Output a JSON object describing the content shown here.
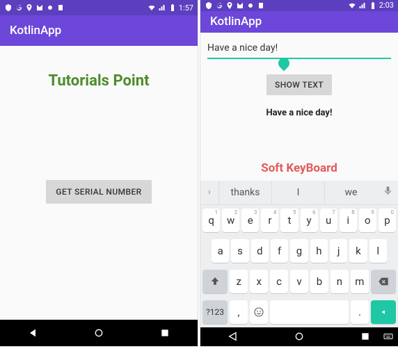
{
  "left": {
    "status": {
      "time": "1:57"
    },
    "app_title": "KotlinApp",
    "heading": "Tutorials Point",
    "button_label": "GET SERIAL NUMBER"
  },
  "right": {
    "status": {
      "time": "2:03"
    },
    "app_title": "KotlinApp",
    "input_value": "Have a nice day!",
    "input_placeholder": "",
    "show_button": "SHOW TEXT",
    "output": "Have a nice day!",
    "soft_label": "Soft KeyBoard",
    "keyboard": {
      "suggestions": [
        "thanks",
        "I",
        "we"
      ],
      "row1": [
        "q",
        "w",
        "e",
        "r",
        "t",
        "y",
        "u",
        "i",
        "o",
        "p"
      ],
      "row1_hints": [
        "1",
        "2",
        "3",
        "4",
        "5",
        "6",
        "7",
        "8",
        "9",
        "0"
      ],
      "row2": [
        "a",
        "s",
        "d",
        "f",
        "g",
        "h",
        "j",
        "k",
        "l"
      ],
      "row3": [
        "z",
        "x",
        "c",
        "v",
        "b",
        "n",
        "m"
      ],
      "sym": "?123",
      "comma": ",",
      "period": "."
    }
  }
}
